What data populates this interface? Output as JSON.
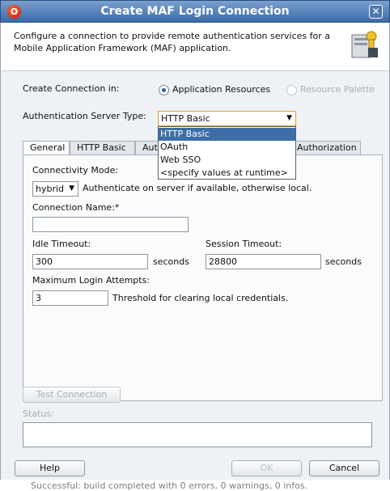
{
  "window": {
    "title": "Create MAF Login Connection",
    "app_icon": "oracle-icon",
    "close_icon": "close-icon"
  },
  "header": {
    "description": "Configure a connection to provide remote authentication services for a Mobile Application Framework (MAF) application.",
    "icon": "connection-key-icon"
  },
  "create_in": {
    "label": "Create Connection in:",
    "option_application": "Application Resources",
    "option_palette": "Resource Palette",
    "selected": "Application Resources"
  },
  "auth_type": {
    "label": "Authentication Server Type:",
    "selected": "HTTP Basic",
    "options": [
      "HTTP Basic",
      "OAuth",
      "Web SSO",
      "<specify values at runtime>"
    ]
  },
  "tabs": {
    "general": "General",
    "http_basic": "HTTP Basic",
    "auth_partial": "Aut",
    "authorization_partial": "Authorization"
  },
  "general": {
    "connectivity_label": "Connectivity Mode:",
    "connectivity_value": "hybrid",
    "connectivity_hint": "Authenticate on server if available, otherwise local.",
    "connection_name_label": "Connection Name:*",
    "connection_name_value": "",
    "idle_timeout_label": "Idle Timeout:",
    "idle_timeout_value": "300",
    "idle_timeout_unit": "seconds",
    "session_timeout_label": "Session Timeout:",
    "session_timeout_value": "28800",
    "session_timeout_unit": "seconds",
    "max_attempts_label": "Maximum Login Attempts:",
    "max_attempts_value": "3",
    "max_attempts_hint": "Threshold for clearing local credentials."
  },
  "test_connection": "Test Connection",
  "status_label": "Status:",
  "status_value": "",
  "buttons": {
    "help": "Help",
    "ok": "OK",
    "cancel": "Cancel"
  },
  "background_log": "Successful: build completed with 0 errors, 0 warnings, 0 infos."
}
